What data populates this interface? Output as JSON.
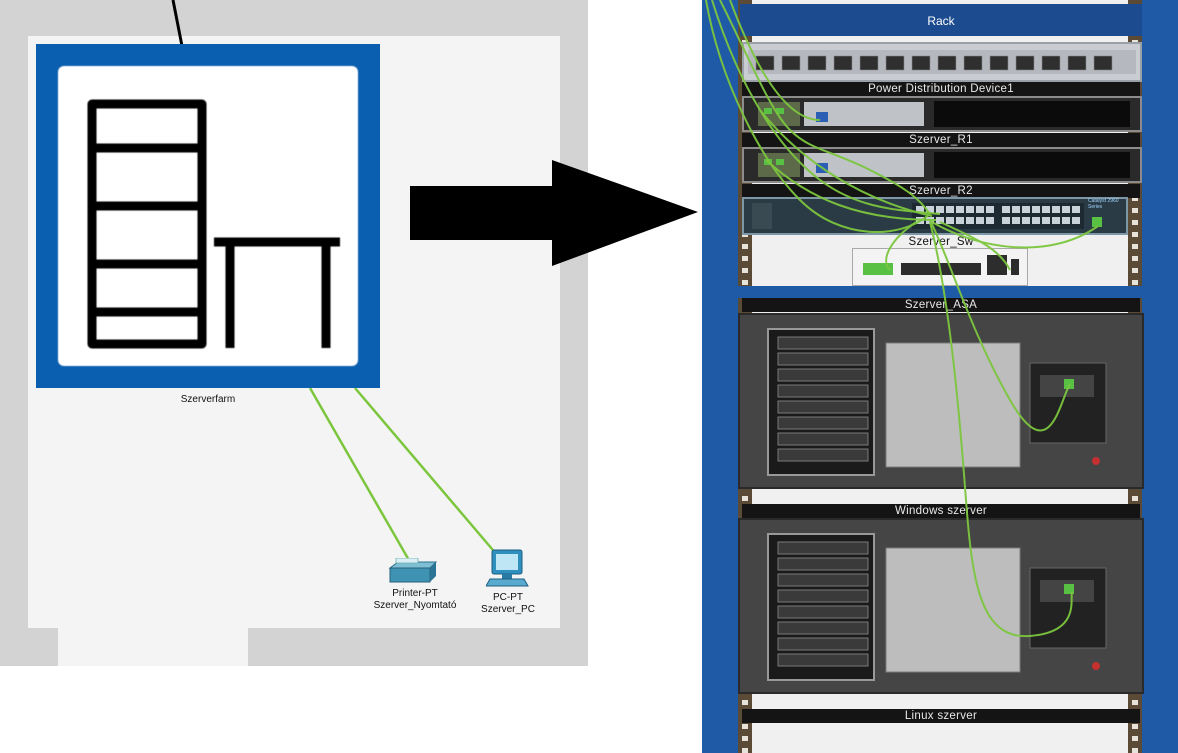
{
  "workspace": {
    "cluster": {
      "label": "Szerverfarm",
      "icon": "server-farm-icon"
    },
    "devices": [
      {
        "type": "Printer-PT",
        "name": "Szerver_Nyomtató",
        "icon": "printer-icon"
      },
      {
        "type": "PC-PT",
        "name": "Szerver_PC",
        "icon": "pc-icon"
      }
    ]
  },
  "rack": {
    "title": "Rack",
    "units": [
      {
        "label": "Power Distribution Device1"
      },
      {
        "label": "Szerver_R1"
      },
      {
        "label": "Szerver_R2"
      },
      {
        "label": "Szerver_Sw"
      },
      {
        "label": "Szerver_ASA"
      },
      {
        "label": "Windows szerver"
      },
      {
        "label": "Linux szerver"
      }
    ],
    "switch_model": "Catalyst 2960 Series"
  },
  "colors": {
    "cable": "#7cc63e",
    "rack_blue": "#1f5aa6",
    "cluster_blue": "#0a5fb0"
  }
}
